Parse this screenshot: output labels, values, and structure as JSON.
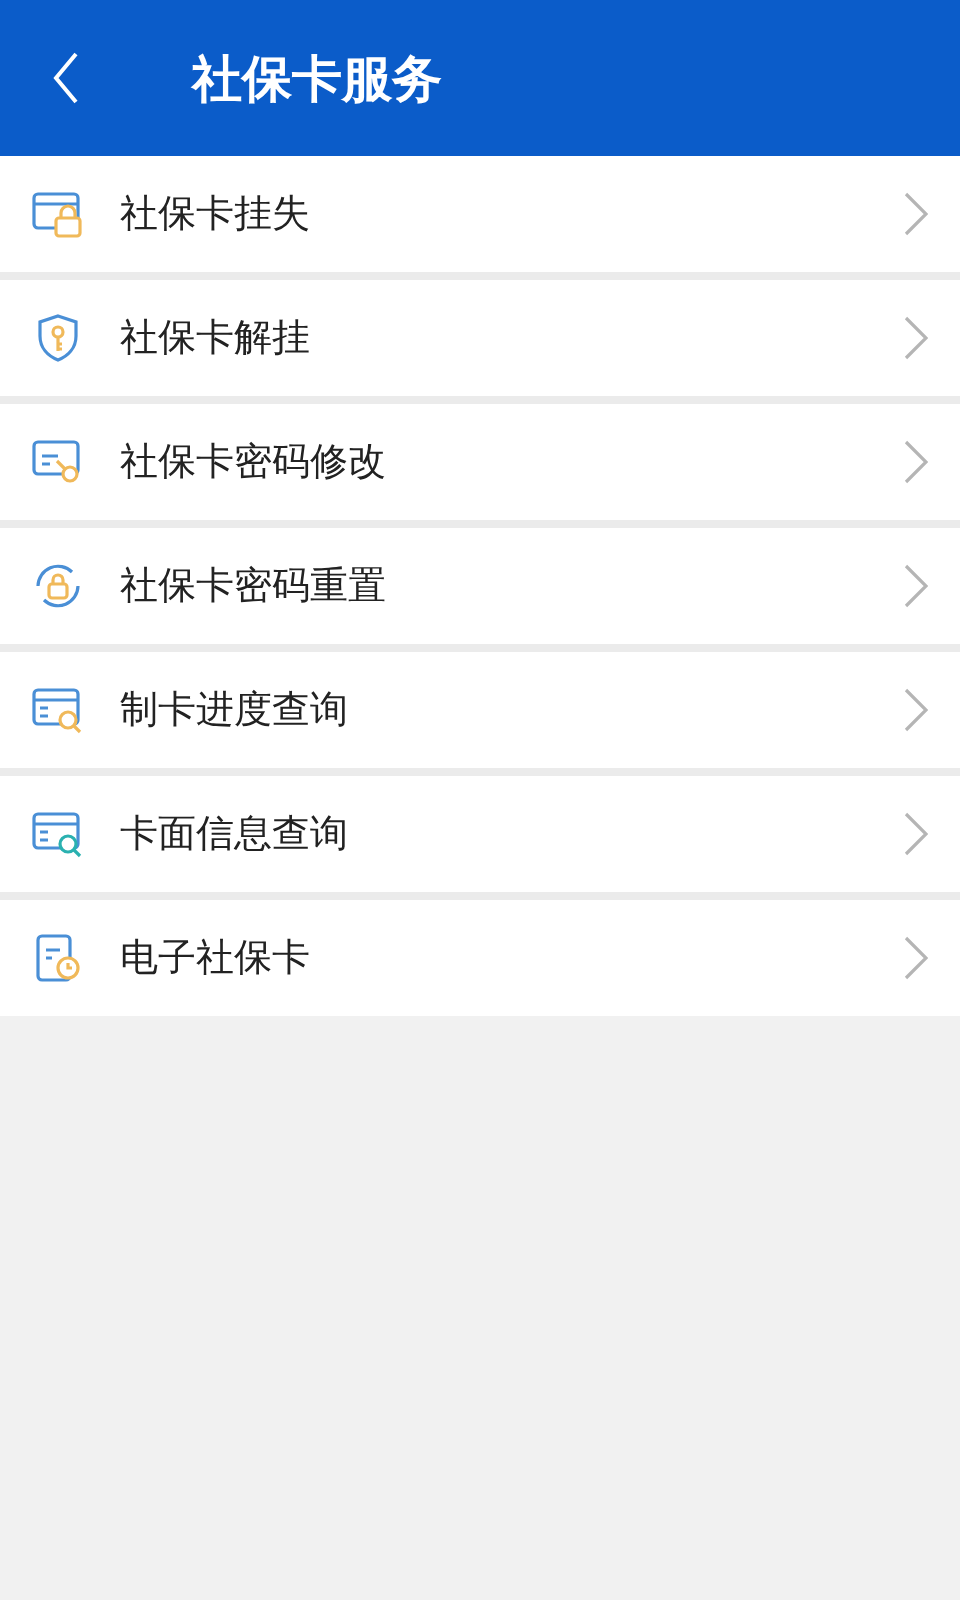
{
  "header": {
    "title": "社保卡服务"
  },
  "items": [
    {
      "label": "社保卡挂失",
      "kind": "card-lock"
    },
    {
      "label": "社保卡解挂",
      "kind": "shield-key"
    },
    {
      "label": "社保卡密码修改",
      "kind": "card-key"
    },
    {
      "label": "社保卡密码重置",
      "kind": "lock-cycle"
    },
    {
      "label": "制卡进度查询",
      "kind": "card-search"
    },
    {
      "label": "卡面信息查询",
      "kind": "card-search-teal"
    },
    {
      "label": "电子社保卡",
      "kind": "doc-clock"
    }
  ]
}
